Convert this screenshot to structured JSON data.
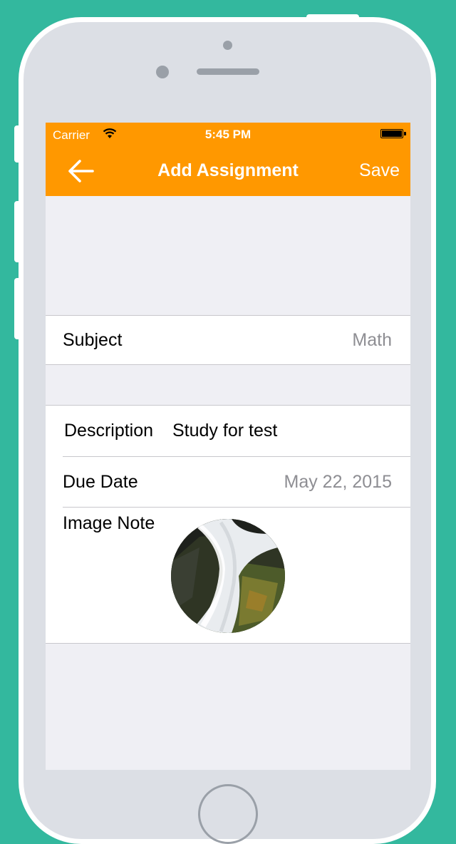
{
  "status_bar": {
    "carrier": "Carrier",
    "time": "5:45 PM"
  },
  "nav": {
    "title": "Add Assignment",
    "save_label": "Save"
  },
  "subject": {
    "label": "Subject",
    "value": "Math"
  },
  "description": {
    "label": "Description",
    "value": "Study for test"
  },
  "due_date": {
    "label": "Due Date",
    "value": "May 22, 2015"
  },
  "image_note": {
    "label": "Image Note"
  },
  "colors": {
    "accent": "#ff9800",
    "background": "#33b89e",
    "screen": "#efeff4"
  },
  "icons": [
    "wifi-icon",
    "battery-icon",
    "back-arrow-icon"
  ]
}
